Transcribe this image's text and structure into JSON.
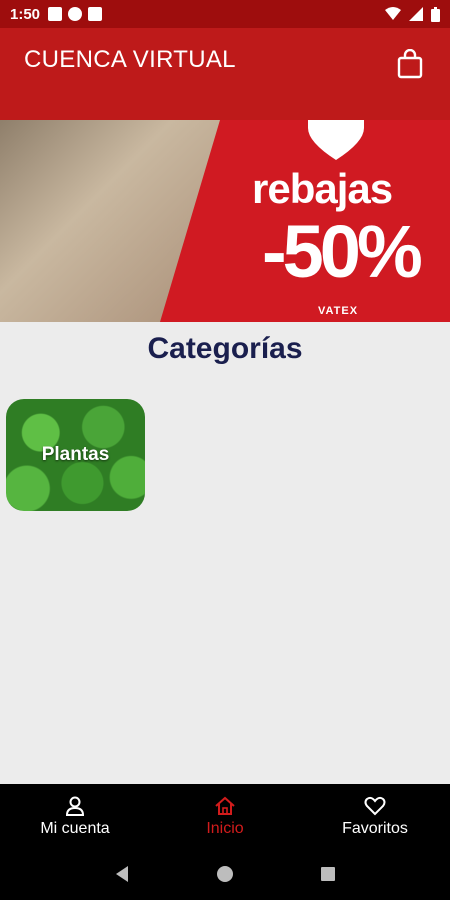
{
  "status_bar": {
    "time": "1:50"
  },
  "app_bar": {
    "title": "CUENCA VIRTUAL"
  },
  "banner": {
    "headline": "rebajas",
    "discount": "-50%",
    "brand": "VATEX"
  },
  "section": {
    "title": "Categorías"
  },
  "categories": [
    {
      "label": "Plantas"
    }
  ],
  "bottom_nav": {
    "items": [
      {
        "label": "Mi cuenta",
        "icon": "person-icon"
      },
      {
        "label": "Inicio",
        "icon": "home-icon",
        "active": true
      },
      {
        "label": "Favoritos",
        "icon": "heart-icon"
      }
    ]
  },
  "colors": {
    "primary": "#be1a1a",
    "status_bar": "#9e0d0d",
    "active_nav": "#d21c1c",
    "title": "#1a1f4e",
    "background": "#ececec"
  }
}
